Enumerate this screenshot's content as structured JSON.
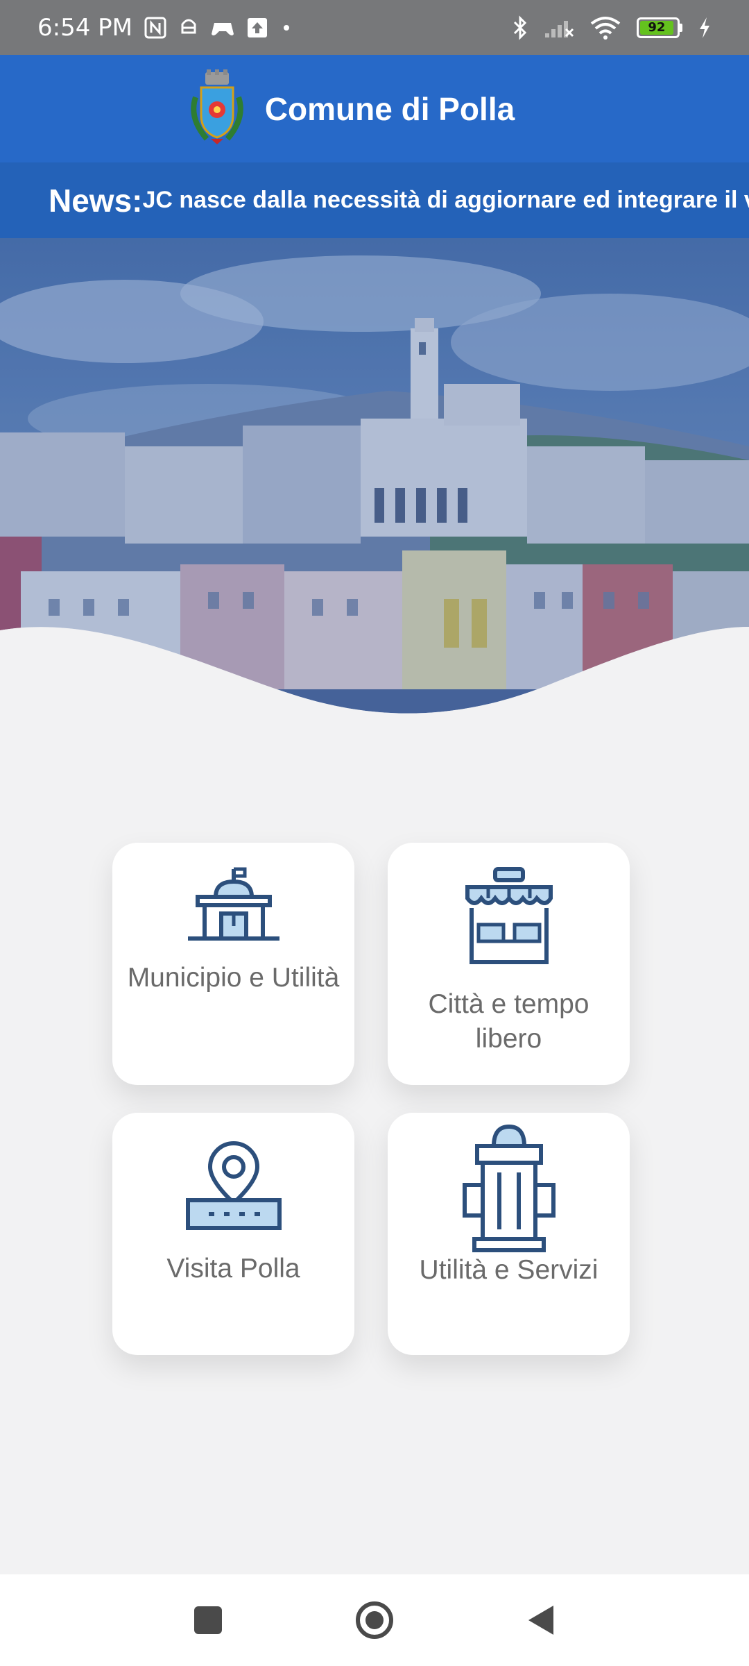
{
  "status_bar": {
    "time": "6:54 PM",
    "battery_level": "92",
    "icons": [
      "nfc-icon",
      "notification-icon",
      "gamepad-icon",
      "upload-icon",
      "dot-icon",
      "bluetooth-icon",
      "signal-icon",
      "wifi-icon",
      "battery-icon",
      "charging-icon"
    ]
  },
  "header": {
    "title": "Comune di Polla",
    "logo": "coat-of-arms-logo"
  },
  "news": {
    "label": "News:",
    "text": "JC nasce dalla necessità di aggiornare ed integrare il v"
  },
  "hero": {
    "image": "town-panorama-image"
  },
  "cards": [
    {
      "label": "Municipio e Utilità",
      "icon": "town-hall-icon"
    },
    {
      "label": "Città e tempo libero",
      "icon": "shop-icon"
    },
    {
      "label": "Visita Polla",
      "icon": "map-pin-icon"
    },
    {
      "label": "Utilità e Servizi",
      "icon": "hydrant-icon"
    }
  ],
  "colors": {
    "header": "#2769c8",
    "news_bar": "#2462b8",
    "icon_dark": "#2c4f7c",
    "icon_light": "#bcd9f0",
    "card_text": "#6a6a6a",
    "background": "#f2f2f3"
  },
  "nav_bar": {
    "buttons": [
      "recents-button",
      "home-button",
      "back-button"
    ]
  }
}
